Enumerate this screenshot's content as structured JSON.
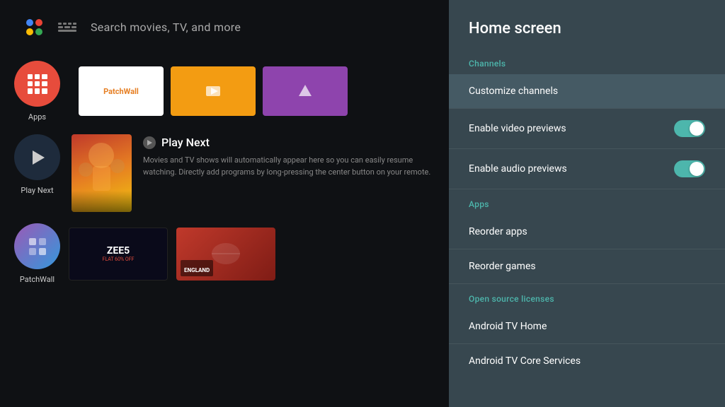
{
  "background": {
    "topBar": {
      "searchPlaceholder": "Search movies, TV, and more"
    },
    "channels": {
      "apps": [
        {
          "label": "Apps",
          "type": "apps-grid"
        },
        {
          "label": "Play Next",
          "type": "play-next"
        },
        {
          "label": "PatchWall",
          "type": "patchwall"
        }
      ],
      "cards": [
        {
          "id": "patchwall",
          "text": "PatchWall"
        },
        {
          "id": "orange",
          "text": ""
        },
        {
          "id": "purple",
          "text": ""
        }
      ]
    },
    "playNext": {
      "title": "Play Next",
      "description": "Movies and TV shows will automatically appear here so you can easily resume watching. Directly add programs by long-pressing the center button on your remote."
    },
    "bottomSection": {
      "label": "PatchWall",
      "card1Label": "FLAT 60% OFF",
      "card2Label": "ENGLAND"
    }
  },
  "panel": {
    "title": "Home screen",
    "sections": [
      {
        "id": "channels",
        "label": "Channels",
        "items": [
          {
            "id": "customize-channels",
            "label": "Customize channels",
            "hasToggle": false,
            "focused": true
          }
        ]
      },
      {
        "id": "previews",
        "label": null,
        "items": [
          {
            "id": "enable-video-previews",
            "label": "Enable video previews",
            "hasToggle": true,
            "toggleOn": true
          },
          {
            "id": "enable-audio-previews",
            "label": "Enable audio previews",
            "hasToggle": true,
            "toggleOn": true
          }
        ]
      },
      {
        "id": "apps",
        "label": "Apps",
        "items": [
          {
            "id": "reorder-apps",
            "label": "Reorder apps",
            "hasToggle": false
          },
          {
            "id": "reorder-games",
            "label": "Reorder games",
            "hasToggle": false
          }
        ]
      },
      {
        "id": "open-source",
        "label": "Open source licenses",
        "items": [
          {
            "id": "android-tv-home",
            "label": "Android TV Home",
            "hasToggle": false
          },
          {
            "id": "android-tv-core",
            "label": "Android TV Core Services",
            "hasToggle": false
          }
        ]
      }
    ]
  },
  "colors": {
    "accent": "#4db6ac",
    "panelBg": "#37474f",
    "focusedItem": "#455a64",
    "textPrimary": "#ffffff",
    "textSecondary": "#888888",
    "sectionLabel": "#4db6ac"
  }
}
